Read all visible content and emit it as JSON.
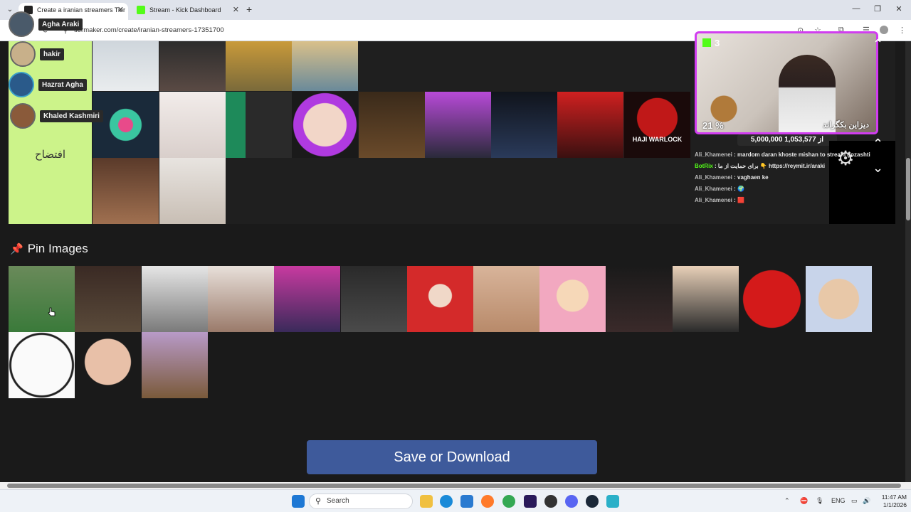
{
  "browser": {
    "tabs": [
      {
        "label": "Create a iranian streamers Tier",
        "active": true
      },
      {
        "label": "Stream - Kick Dashboard",
        "active": false
      }
    ],
    "url": "tiermaker.com/create/iranian-streamers-17351700"
  },
  "streamer_badges": [
    {
      "name": "Agha Araki"
    },
    {
      "name": "hakir"
    },
    {
      "name": "Hazrat Agha"
    },
    {
      "name": "Khaled Kashmiri"
    }
  ],
  "tier": {
    "label": "افتضاح",
    "label_color": "#ccf38a",
    "haji_warlock_text": "HAJI WARLOCK"
  },
  "pin_section": {
    "icon": "pin-icon",
    "title": "Pin Images"
  },
  "save_button": {
    "label": "Save or Download",
    "color": "#3e5a9b"
  },
  "stream_overlay": {
    "viewers": "3",
    "progress_text": "21 %",
    "title_text": "دیزاین بکگراند",
    "goal_text": "5,000,000 از 1,053,577",
    "chat": [
      {
        "user": "Ali_Khamenei",
        "message": "mardom daran khoste mishan to stream gozashti",
        "bot": false
      },
      {
        "user": "BotRix",
        "message": "برای حمایت از ما 👇 https://reymit.ir/araki",
        "bot": true
      },
      {
        "user": "Ali_Khamenei",
        "message": "vaghaen ke",
        "bot": false
      },
      {
        "user": "Ali_Khamenei",
        "message": "🌍",
        "bot": false
      },
      {
        "user": "Ali_Khamenei",
        "message": "🟥",
        "bot": false
      }
    ]
  },
  "taskbar": {
    "search_placeholder": "Search",
    "lang": "ENG",
    "time": "11:47 AM",
    "date": "1/1/2026"
  },
  "colors": {
    "page_bg": "#1a1a1a",
    "accent_purple": "#d13df0",
    "kick_green": "#53fc18",
    "pin_pink": "#e0457b"
  }
}
